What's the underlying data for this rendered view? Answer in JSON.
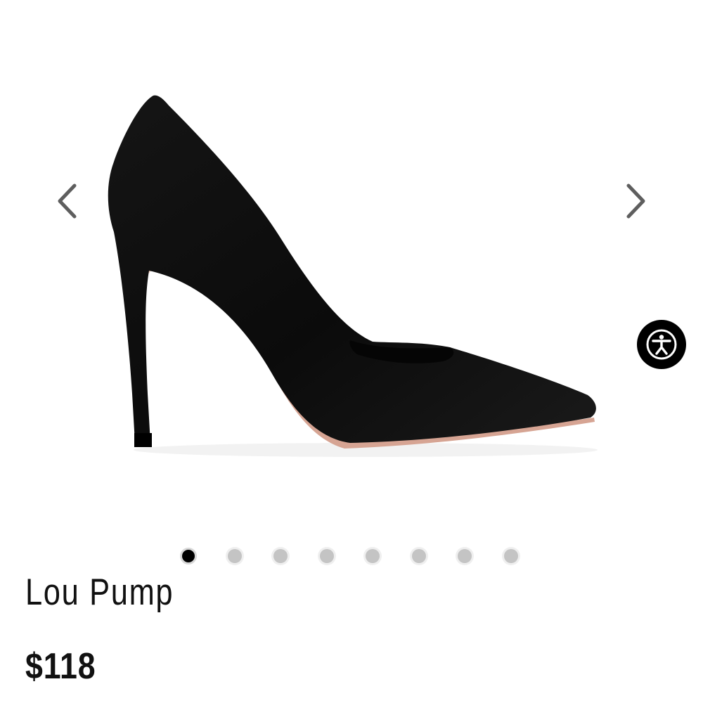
{
  "product": {
    "name": "Lou Pump",
    "price": "$118"
  },
  "gallery": {
    "image_name": "black-suede-pointed-toe-stiletto-pump",
    "image_count": 8,
    "active_index": 0,
    "prev_icon": "chevron-left-icon",
    "next_icon": "chevron-right-icon"
  },
  "accessibility": {
    "icon": "accessibility-person-icon"
  },
  "colors": {
    "background": "#ffffff",
    "text": "#111111",
    "arrow": "#5e5e5e",
    "dot_active": "#000000",
    "dot_inactive": "#c4c4c4"
  }
}
